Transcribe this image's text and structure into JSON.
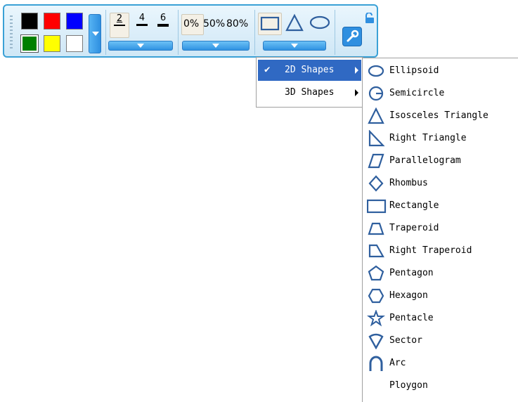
{
  "toolbar": {
    "colors": {
      "black": "#000000",
      "red": "#ff0000",
      "blue": "#0000ff",
      "green": "#008000",
      "yellow": "#ffff00",
      "white": "#ffffff"
    },
    "widths": [
      "2",
      "4",
      "6"
    ],
    "transparency": [
      "0%",
      "50%",
      "80%"
    ]
  },
  "menu": {
    "items": [
      {
        "label": "2D Shapes",
        "checked": true,
        "selected": true
      },
      {
        "label": "3D Shapes",
        "checked": false,
        "selected": false
      }
    ]
  },
  "submenu": {
    "items": [
      {
        "label": "Ellipsoid",
        "icon": "ellipse-icon"
      },
      {
        "label": "Semicircle",
        "icon": "semicircle-icon"
      },
      {
        "label": "Isosceles Triangle",
        "icon": "isosceles-triangle-icon"
      },
      {
        "label": "Right Triangle",
        "icon": "right-triangle-icon"
      },
      {
        "label": "Parallelogram",
        "icon": "parallelogram-icon"
      },
      {
        "label": "Rhombus",
        "icon": "rhombus-icon"
      },
      {
        "label": "Rectangle",
        "icon": "rectangle-icon"
      },
      {
        "label": "Traperoid",
        "icon": "trapezoid-icon"
      },
      {
        "label": "Right Traperoid",
        "icon": "right-trapezoid-icon"
      },
      {
        "label": "Pentagon",
        "icon": "pentagon-icon"
      },
      {
        "label": "Hexagon",
        "icon": "hexagon-icon"
      },
      {
        "label": "Pentacle",
        "icon": "star-icon"
      },
      {
        "label": "Sector",
        "icon": "sector-icon"
      },
      {
        "label": "Arc",
        "icon": "arc-icon"
      },
      {
        "label": "Ploygon",
        "icon": ""
      }
    ]
  },
  "accent": "#3069c3",
  "icon_color": "#2f5f9e"
}
